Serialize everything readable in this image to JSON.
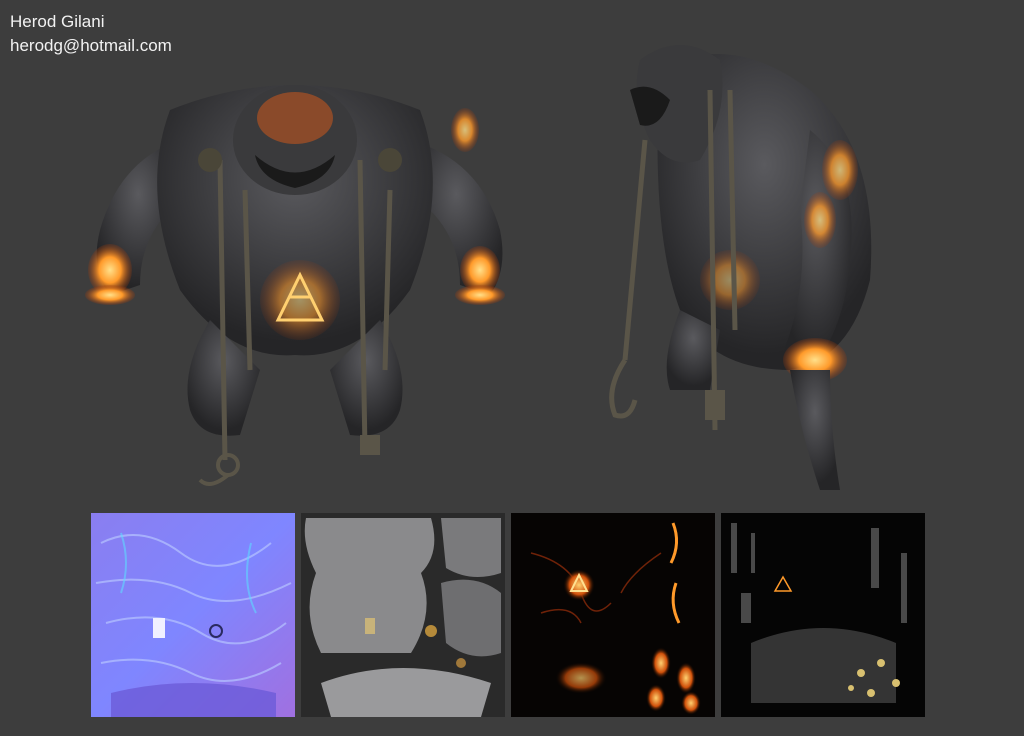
{
  "author": {
    "name": "Herod Gilani",
    "email": "herodg@hotmail.com"
  },
  "colors": {
    "background": "#3d3d3d",
    "skin": "#3a3a3c",
    "glow": "#ff9a2a",
    "chain": "#5a5548"
  },
  "renders": [
    "front-view",
    "side-view"
  ],
  "texture_maps": [
    "normal-map",
    "diffuse-map",
    "emissive-map",
    "specular-map"
  ]
}
